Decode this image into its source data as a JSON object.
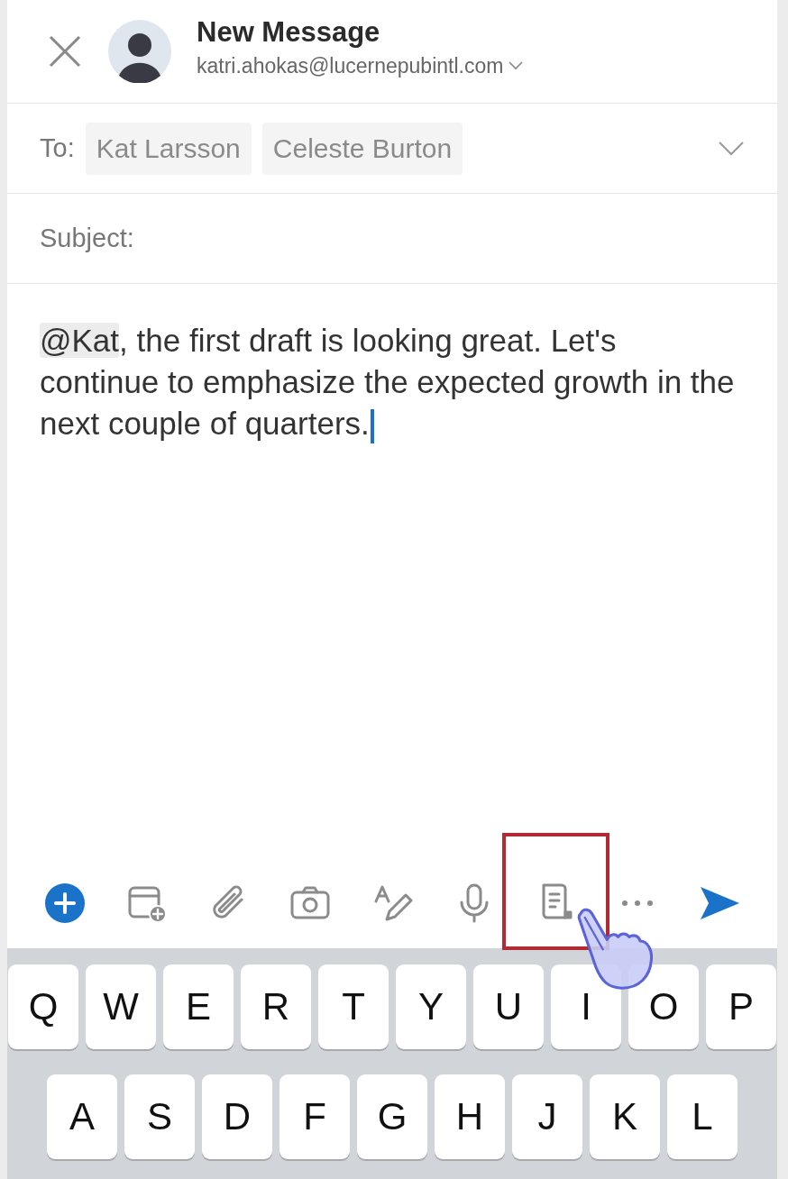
{
  "header": {
    "title": "New Message",
    "account": "katri.ahokas@lucernepubintl.com"
  },
  "to": {
    "label": "To:",
    "recipients": [
      "Kat Larsson",
      "Celeste Burton"
    ]
  },
  "subject": {
    "placeholder": "Subject:"
  },
  "body": {
    "mention": "@Kat",
    "text": ", the first draft is looking great. Let's continue to emphasize the expected growth in the next couple of quarters."
  },
  "toolbar": [
    {
      "kind": "add",
      "highlighted": false
    },
    {
      "kind": "calendar",
      "highlighted": false
    },
    {
      "kind": "attach",
      "highlighted": false
    },
    {
      "kind": "camera",
      "highlighted": false
    },
    {
      "kind": "draw",
      "highlighted": false
    },
    {
      "kind": "mic",
      "highlighted": false
    },
    {
      "kind": "template",
      "highlighted": true
    },
    {
      "kind": "more",
      "highlighted": false
    },
    {
      "kind": "send",
      "highlighted": false
    }
  ],
  "keyboard": [
    [
      "Q",
      "W",
      "E",
      "R",
      "T",
      "Y",
      "U",
      "I",
      "O",
      "P"
    ],
    [
      "A",
      "S",
      "D",
      "F",
      "G",
      "H",
      "J",
      "K",
      "L"
    ]
  ]
}
